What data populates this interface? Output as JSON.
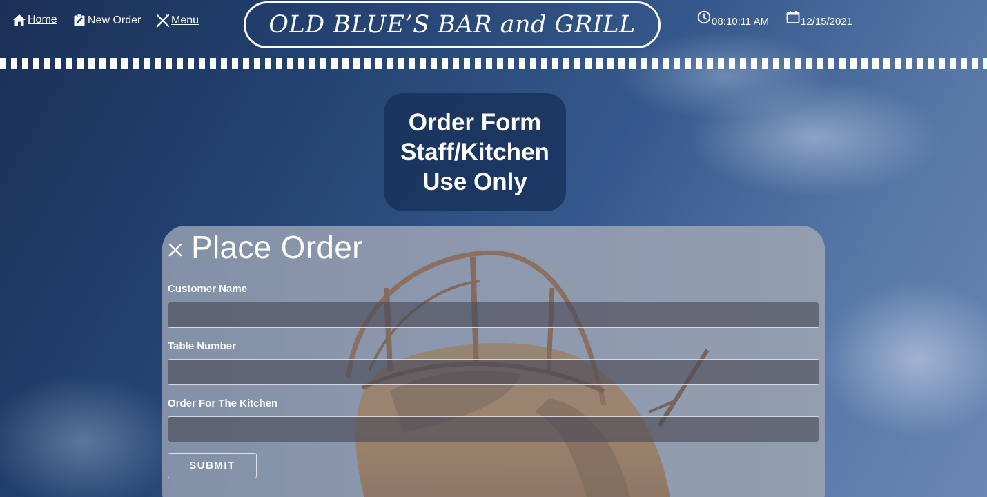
{
  "nav": {
    "home_label": "Home",
    "home_icon": "home-icon",
    "new_order_label": "New Order",
    "new_order_icon": "edit-note-icon",
    "menu_label": "Menu",
    "menu_icon": "utensils-icon"
  },
  "brand": {
    "title": "OLD BLUE’S BAR and GRILL"
  },
  "status": {
    "time": "08:10:11 AM",
    "time_icon": "clock-icon",
    "date": "12/15/2021",
    "date_icon": "calendar-icon"
  },
  "page_title": {
    "line1": "Order Form",
    "line2": "Staff/Kitchen",
    "line3": "Use Only"
  },
  "order_form": {
    "heading": "Place Order",
    "heading_icon": "utensils-icon",
    "customer_name_label": "Customer Name",
    "customer_name_value": "",
    "table_number_label": "Table Number",
    "table_number_value": "",
    "kitchen_order_label": "Order For The Kitchen",
    "kitchen_order_value": "",
    "submit_label": "SUBMIT"
  },
  "colors": {
    "header_bg": "#1b3057",
    "title_box_bg": "#163058",
    "panel_bg": "#8c97a9",
    "input_bg": "#484856",
    "text": "#ffffff"
  }
}
